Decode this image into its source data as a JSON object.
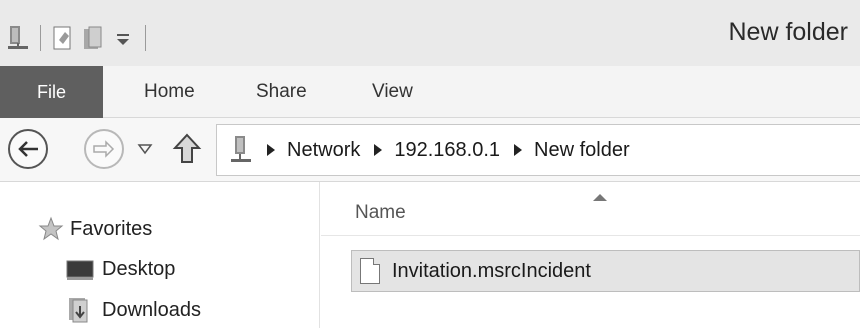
{
  "window": {
    "title": "New folder"
  },
  "qat": {
    "icons": [
      "network-drive-icon",
      "properties-icon",
      "new-folder-icon",
      "customize-qat-icon"
    ]
  },
  "ribbon": {
    "tabs": [
      {
        "label": "File",
        "active": true
      },
      {
        "label": "Home"
      },
      {
        "label": "Share"
      },
      {
        "label": "View"
      }
    ]
  },
  "address": {
    "breadcrumbs": [
      "Network",
      "192.168.0.1",
      "New folder"
    ]
  },
  "navigation_pane": {
    "items": [
      {
        "label": "Favorites",
        "icon": "star-icon"
      },
      {
        "label": "Desktop",
        "icon": "desktop-icon"
      },
      {
        "label": "Downloads",
        "icon": "downloads-icon"
      }
    ]
  },
  "content": {
    "column_header": "Name",
    "files": [
      {
        "name": "Invitation.msrcIncident",
        "selected": true
      }
    ]
  },
  "colors": {
    "file_tab_bg": "#5f5f5f",
    "selection_bg": "#e4e4e4",
    "titlebar_bg": "#eaeaea"
  }
}
